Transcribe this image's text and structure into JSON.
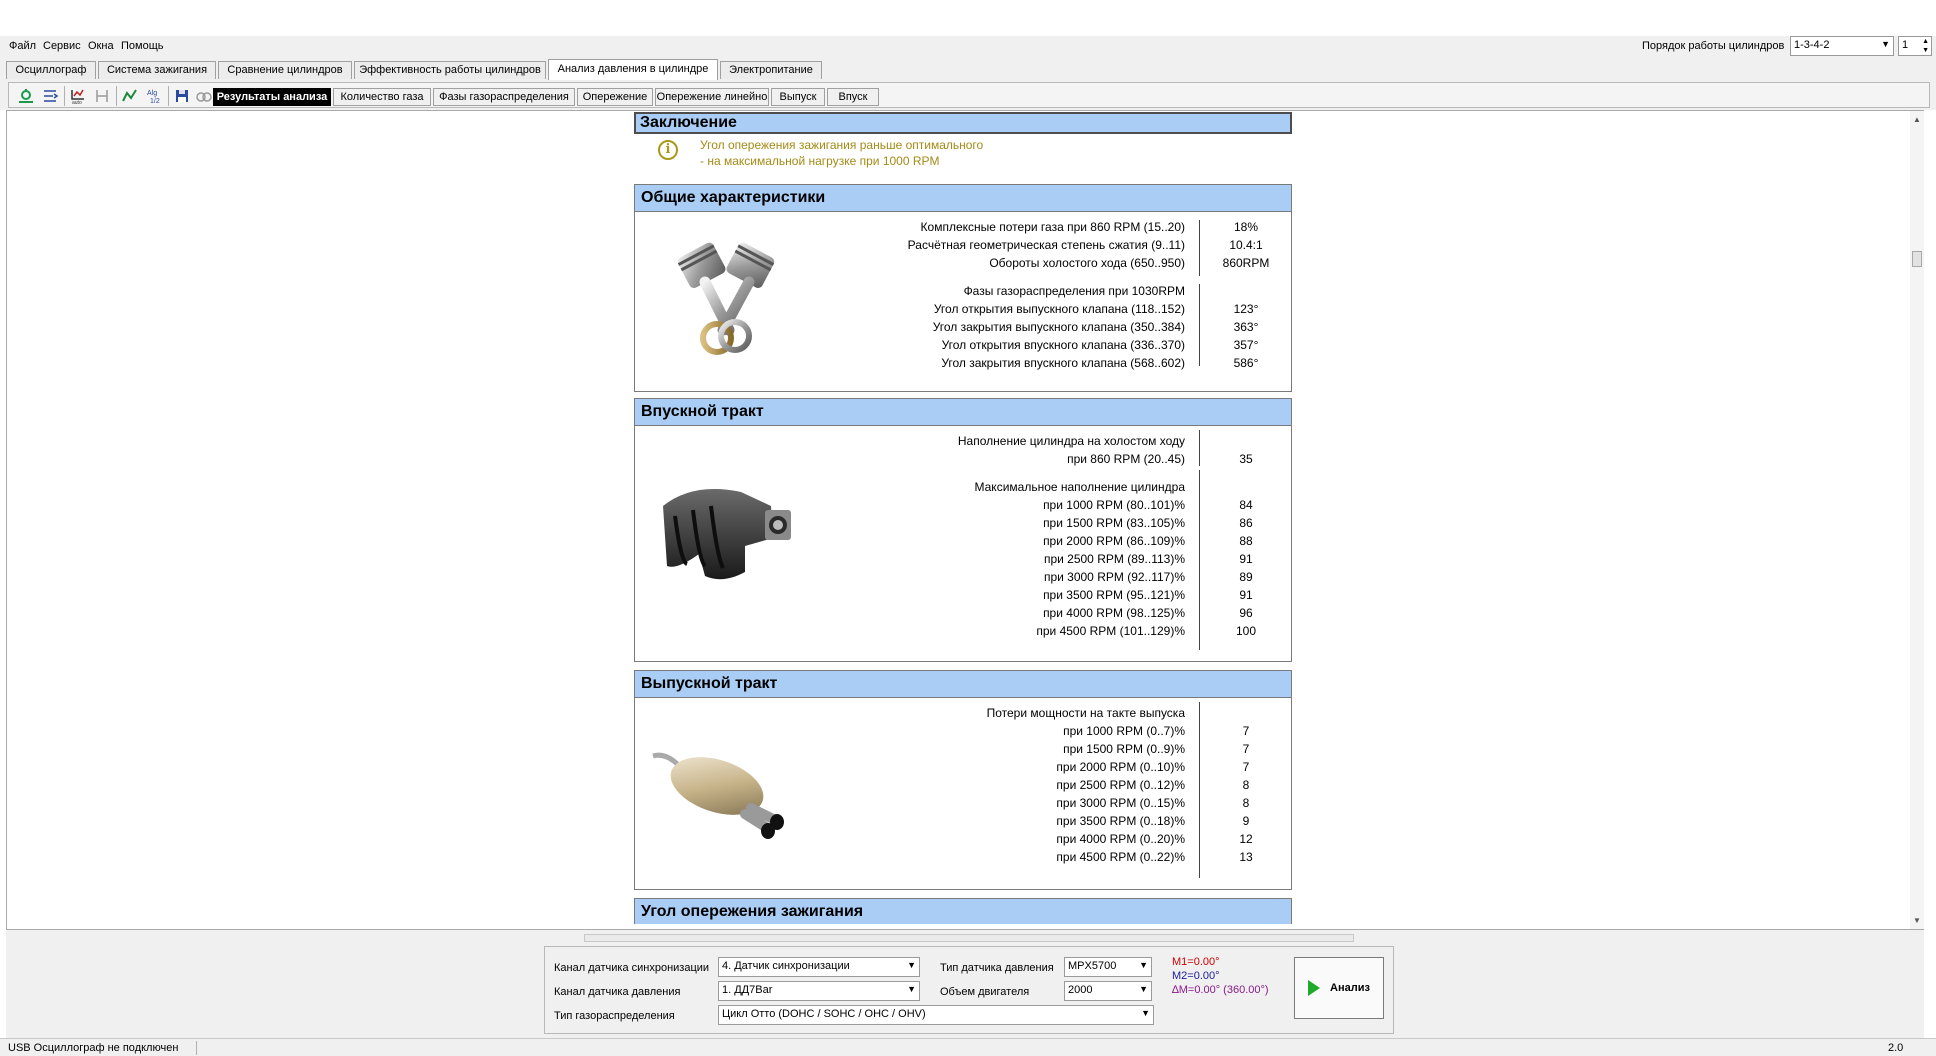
{
  "menu": [
    "Файл",
    "Сервис",
    "Окна",
    "Помощь"
  ],
  "cylinder_order": {
    "label": "Порядок работы цилиндров",
    "value": "1-3-4-2",
    "spin_value": "1"
  },
  "main_tabs": [
    "Осциллограф",
    "Система зажигания",
    "Сравнение цилиндров",
    "Эффективность работы цилиндров",
    "Анализ давления в цилиндре",
    "Электропитание"
  ],
  "main_tab_active": "Анализ давления в цилиндре",
  "toolbar_icons": [
    "sync-icon",
    "pressure-scale-icon",
    "auto-icon",
    "marker-icon",
    "waveform-icon",
    "algorithm-icon",
    "save-icon",
    "compare-icon"
  ],
  "sub_tabs": [
    "Результаты анализа",
    "Количество газа",
    "Фазы газораспределения",
    "Опережение",
    "Опережение линейно",
    "Выпуск",
    "Впуск"
  ],
  "sub_tab_active": "Результаты анализа",
  "conclusion": {
    "title": "Заключение",
    "lines": [
      "Угол опережения зажигания раньше оптимального",
      "- на максимальной нагрузке при 1000 RPM"
    ]
  },
  "general": {
    "title": "Общие характеристики",
    "image": "engine-piston-icon",
    "rows": [
      {
        "label": "Комплексные потери газа при 860 RPM (15..20)",
        "value": "18%"
      },
      {
        "label": "Расчётная геометрическая степень сжатия (9..11)",
        "value": "10.4:1"
      },
      {
        "label": "Обороты холостого хода (650..950)",
        "value": "860RPM"
      },
      {
        "label": "Фазы газораспределения при 1030RPM",
        "value": ""
      },
      {
        "label": "Угол открытия выпускного клапана (118..152)",
        "value": "123°"
      },
      {
        "label": "Угол закрытия выпускного клапана (350..384)",
        "value": "363°"
      },
      {
        "label": "Угол открытия впускного клапана (336..370)",
        "value": "357°"
      },
      {
        "label": "Угол закрытия впускного клапана (568..602)",
        "value": "586°"
      }
    ]
  },
  "intake": {
    "title": "Впускной тракт",
    "image": "intake-manifold-icon",
    "rows": [
      {
        "label": "Наполнение цилиндра на холостом ходу",
        "value": ""
      },
      {
        "label": "при 860 RPM (20..45)",
        "value": "35"
      },
      {
        "label": "Максимальное наполнение цилиндра",
        "value": ""
      },
      {
        "label": "при  1000 RPM (80..101)%",
        "value": "84"
      },
      {
        "label": "при  1500 RPM (83..105)%",
        "value": "86"
      },
      {
        "label": "при  2000 RPM (86..109)%",
        "value": "88"
      },
      {
        "label": "при  2500 RPM (89..113)%",
        "value": "91"
      },
      {
        "label": "при  3000 RPM (92..117)%",
        "value": "89"
      },
      {
        "label": "при  3500 RPM (95..121)%",
        "value": "91"
      },
      {
        "label": "при  4000 RPM (98..125)%",
        "value": "96"
      },
      {
        "label": "при  4500 RPM (101..129)%",
        "value": "100"
      }
    ]
  },
  "exhaust": {
    "title": "Выпускной тракт",
    "image": "muffler-icon",
    "rows": [
      {
        "label": "Потери мощности на такте выпуска",
        "value": ""
      },
      {
        "label": "при  1000 RPM (0..7)%",
        "value": "7"
      },
      {
        "label": "при  1500 RPM (0..9)%",
        "value": "7"
      },
      {
        "label": "при  2000 RPM (0..10)%",
        "value": "7"
      },
      {
        "label": "при  2500 RPM (0..12)%",
        "value": "8"
      },
      {
        "label": "при  3000 RPM (0..15)%",
        "value": "8"
      },
      {
        "label": "при  3500 RPM (0..18)%",
        "value": "9"
      },
      {
        "label": "при  4000 RPM (0..20)%",
        "value": "12"
      },
      {
        "label": "при  4500 RPM (0..22)%",
        "value": "13"
      }
    ]
  },
  "ignition": {
    "title": "Угол опережения зажигания"
  },
  "settings": {
    "sync_channel_label": "Канал датчика синхронизации",
    "sync_channel_value": "4.  Датчик синхронизации",
    "pressure_channel_label": "Канал датчика давления",
    "pressure_channel_value": "1.  ДД7Bar",
    "timing_type_label": "Тип газораспределения",
    "timing_type_value": "Цикл Отто (DOHC / SOHC / OHC / OHV)",
    "sensor_type_label": "Тип датчика давления",
    "sensor_type_value": "MPX5700",
    "engine_volume_label": "Объем двигателя",
    "engine_volume_value": "2000",
    "m1": "M1=0.00°",
    "m2": "M2=0.00°",
    "dm": "∆M=0.00° (360.00°)",
    "m1_color": "#cc0000",
    "m2_color": "#1a1a99",
    "dm_color": "#8a1a8a",
    "analyze_label": "Анализ"
  },
  "status": {
    "connection": "USB Осциллограф не подключен",
    "version": "2.0"
  },
  "colors": {
    "section_header": "#a9cdf4",
    "conclusion_text": "#a48a15",
    "accent_green": "#1faa2a"
  }
}
